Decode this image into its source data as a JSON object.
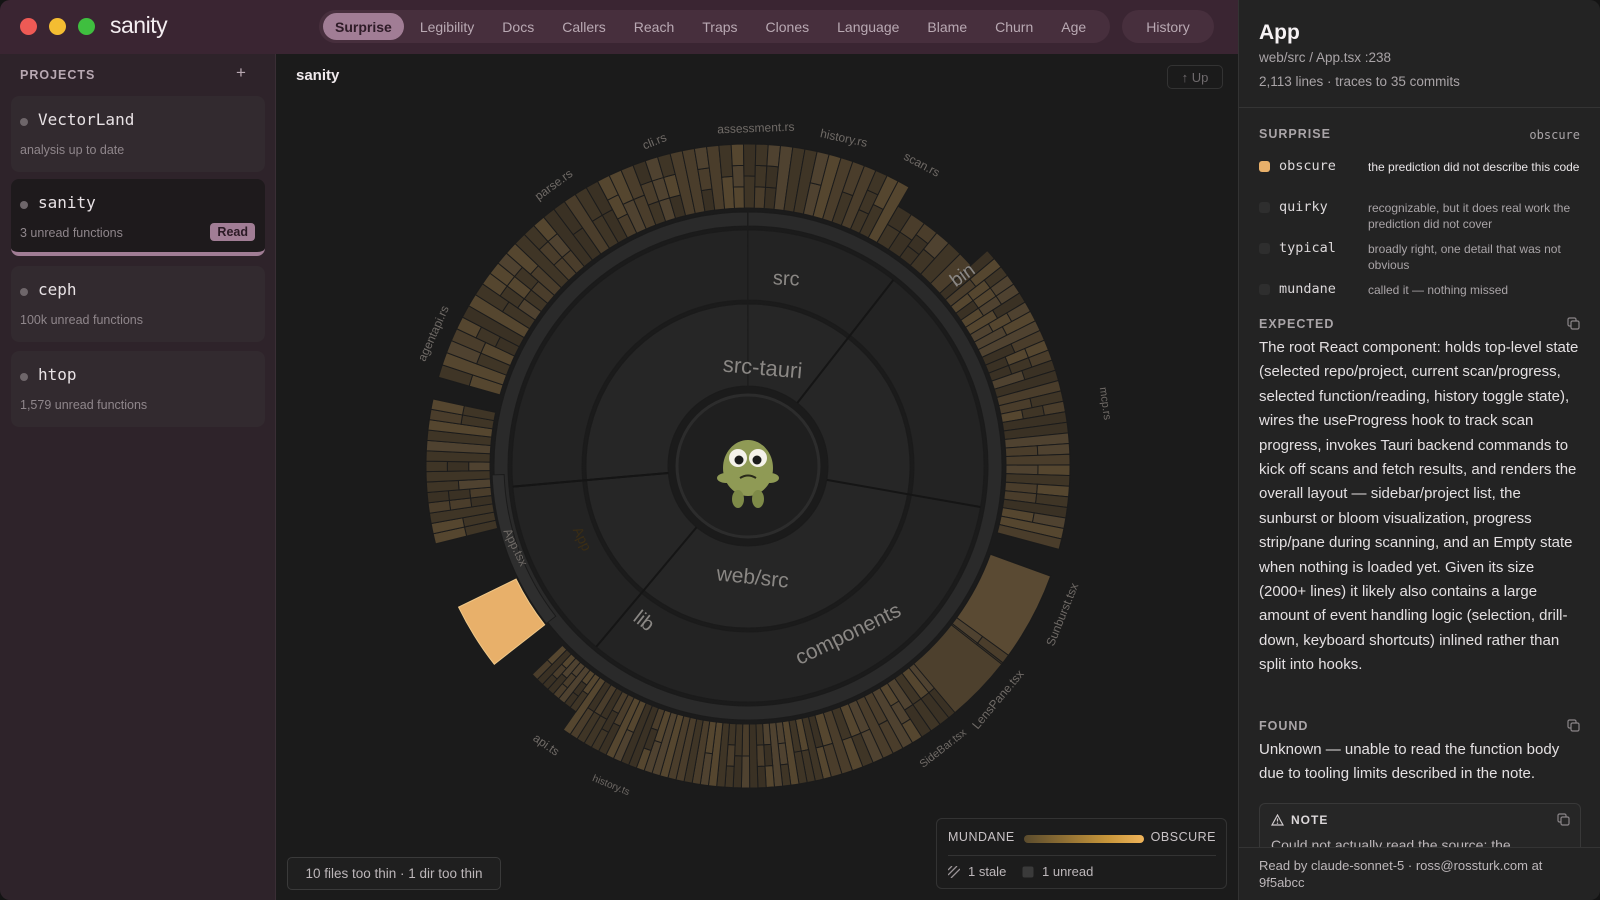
{
  "app": {
    "name": "sanity"
  },
  "tabs": [
    {
      "label": "Surprise",
      "active": true
    },
    {
      "label": "Legibility"
    },
    {
      "label": "Docs"
    },
    {
      "label": "Callers"
    },
    {
      "label": "Reach"
    },
    {
      "label": "Traps"
    },
    {
      "label": "Clones"
    },
    {
      "label": "Language"
    },
    {
      "label": "Blame"
    },
    {
      "label": "Churn"
    },
    {
      "label": "Age"
    }
  ],
  "history_label": "History",
  "sidebar": {
    "header": "PROJECTS",
    "add": "+",
    "projects": [
      {
        "name": "VectorLand",
        "sub": "analysis up to date"
      },
      {
        "name": "sanity",
        "sub": "3 unread functions",
        "badge": "Read",
        "active": true
      },
      {
        "name": "ceph",
        "sub": "100k unread functions"
      },
      {
        "name": "htop",
        "sub": "1,579 unread functions"
      }
    ]
  },
  "main": {
    "breadcrumb": "sanity",
    "up_label": "↑ Up",
    "rings": {
      "src_tauri": "src-tauri",
      "src": "src",
      "bin": "bin",
      "web_src": "web/src",
      "components": "components",
      "lib": "lib",
      "selected": "App"
    },
    "file_labels": {
      "cli": "cli.rs",
      "assessment": "assessment.rs",
      "history": "history.rs",
      "scan": "scan.rs",
      "parse": "parse.rs",
      "agentapi": "agentapi.rs",
      "mcp": "mcp.rs",
      "app_tsx": "App.tsx",
      "sunburst_tsx": "Sunburst.tsx",
      "lenspane_tsx": "LensPane.tsx",
      "sidebar_tsx": "SideBar.tsx",
      "api_ts": "api.ts",
      "history_ts": "history.ts"
    },
    "thin_notice": "10 files too thin · 1 dir too thin",
    "legend": {
      "low": "MUNDANE",
      "high": "OBSCURE",
      "stale": "1 stale",
      "unread": "1 unread"
    }
  },
  "panel": {
    "title": "App",
    "path": "web/src / App.tsx :238",
    "meta": "2,113 lines · traces to 35 commits",
    "surprise": {
      "header": "SURPRISE",
      "value": "obscure",
      "levels": [
        {
          "name": "obscure",
          "desc": "the prediction did not describe this code",
          "selected": true
        },
        {
          "name": "quirky",
          "desc": "recognizable, but it does real work the prediction did not cover"
        },
        {
          "name": "typical",
          "desc": "broadly right, one detail that was not obvious"
        },
        {
          "name": "mundane",
          "desc": "called it — nothing missed"
        }
      ]
    },
    "expected": {
      "header": "EXPECTED",
      "text": "The root React component: holds top-level state (selected repo/project, current scan/progress, selected function/reading, history toggle state), wires the useProgress hook to track scan progress, invokes Tauri backend commands to kick off scans and fetch results, and renders the overall layout — sidebar/project list, the sunburst or bloom visualization, progress strip/pane during scanning, and an Empty state when nothing is loaded yet. Given its size (2000+ lines) it likely also contains a large amount of event handling logic (selection, drill-down, keyboard shortcuts) inlined rather than split into hooks."
    },
    "found": {
      "header": "FOUND",
      "text": "Unknown — unable to read the function body due to tooling limits described in the note."
    },
    "note": {
      "header": "NOTE",
      "text": "Could not actually read the source: the"
    },
    "footer": "Read by claude-sonnet-5 · ross@rossturk.com at 9f5abcc"
  },
  "colors": {
    "accent": "#a17d95",
    "titlebar": "#3a2532",
    "selected_fill": "#e8b06a",
    "cell_fill": "#4a3d2b"
  },
  "icons": {
    "copy": "copy-icon",
    "warning": "warning-icon",
    "stale": "stale-stripes-icon",
    "unread": "unread-square-icon",
    "mascot": "mascot-icon"
  }
}
